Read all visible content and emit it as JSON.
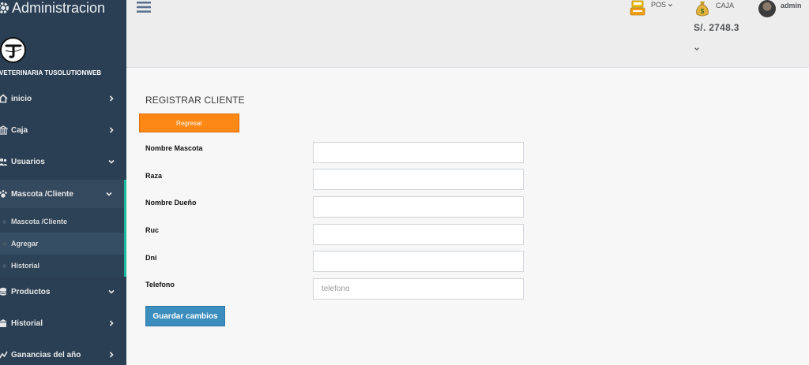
{
  "sidebar": {
    "brand": "Administracion",
    "clinic_name": "VETERINARIA TUSOLUTIONWEB",
    "items": [
      {
        "label": "inicio"
      },
      {
        "label": "Caja"
      },
      {
        "label": "Usuarios"
      },
      {
        "label": "Mascota /Cliente"
      },
      {
        "label": "Productos"
      },
      {
        "label": "Historial"
      },
      {
        "label": "Ganancias del año"
      }
    ],
    "submenu": [
      {
        "label": "Mascota /Cliente"
      },
      {
        "label": "Agregar"
      },
      {
        "label": "Historial"
      }
    ]
  },
  "topbar": {
    "pos_label": "POS",
    "caja_label": "CAJA",
    "caja_amount": "S/. 2748.3",
    "user_name": "admin"
  },
  "form": {
    "title": "REGISTRAR CLIENTE",
    "back_label": "Regresar",
    "fields": [
      {
        "label": "Nombre Mascota",
        "value": "",
        "placeholder": ""
      },
      {
        "label": "Raza",
        "value": "",
        "placeholder": ""
      },
      {
        "label": "Nombre Dueño",
        "value": "",
        "placeholder": ""
      },
      {
        "label": "Ruc",
        "value": "",
        "placeholder": ""
      },
      {
        "label": "Dni",
        "value": "",
        "placeholder": ""
      },
      {
        "label": "Telefono",
        "value": "",
        "placeholder": "telefono"
      }
    ],
    "save_label": "Guardar cambios"
  },
  "colors": {
    "sidebar_bg": "#2a3f54",
    "active_accent": "#1abb9c",
    "back_button": "#fd8815",
    "save_button": "#3b8dbd"
  }
}
